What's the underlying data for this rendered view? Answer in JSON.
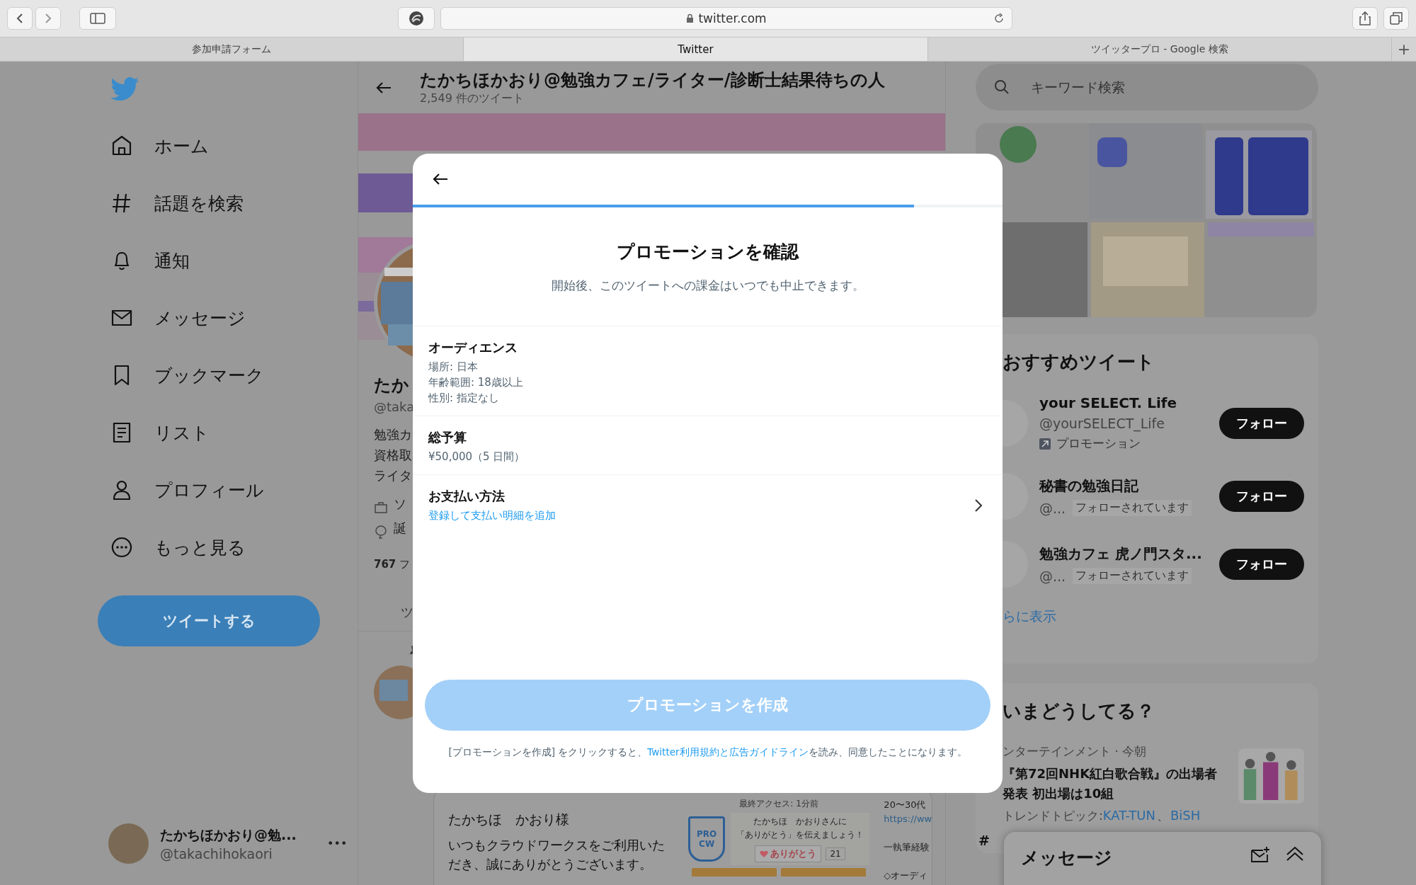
{
  "browser": {
    "url": "twitter.com",
    "tabs": [
      {
        "label": "参加申請フォーム",
        "selected": false
      },
      {
        "label": "Twitter",
        "selected": true
      },
      {
        "label": "ツイッタープロ - Google 検索",
        "selected": false
      }
    ],
    "new_tab": "+"
  },
  "nav": {
    "items": [
      {
        "label": "ホーム",
        "kind": "home"
      },
      {
        "label": "話題を検索",
        "kind": "hash"
      },
      {
        "label": "通知",
        "kind": "bell"
      },
      {
        "label": "メッセージ",
        "kind": "mail"
      },
      {
        "label": "ブックマーク",
        "kind": "bookmark"
      },
      {
        "label": "リスト",
        "kind": "list"
      },
      {
        "label": "プロフィール",
        "kind": "person"
      },
      {
        "label": "もっと見る",
        "kind": "more"
      }
    ],
    "tweet_button": "ツイートする",
    "account": {
      "name": "たかちほかおり@勉...",
      "handle": "@takachihokaori",
      "more": "•••"
    }
  },
  "profile": {
    "name": "たかちほかおり@勉強カフェ/ライター/診断士結果待ちの人",
    "tweet_count": "2,549 件のツイート",
    "name_fragment": "たか",
    "handle_fragment": "@taka",
    "bio_lines": [
      "勉強カ",
      "資格取",
      "ライタ"
    ],
    "meta": [
      {
        "kind": "work",
        "text": "ソ"
      },
      {
        "kind": "birthday",
        "text": "誕"
      }
    ],
    "following": "**767** フ",
    "tab_fragment": "ツ",
    "tweet_card": {
      "greeting": "たかちほ　かおり様",
      "message": "いつもクラウドワークスをご利用いただき、誠にありがとうございます。",
      "last_access": "最終アクセス: 1分前",
      "badge": [
        "PRO",
        "CW"
      ],
      "thanks_lines": [
        "たかちほ　かおりさんに",
        "「ありがとう」を伝えましょう！"
      ],
      "thanks_button": "ありがとう",
      "thanks_count": "21",
      "side_lines": [
        "20〜30代",
        "https://ww",
        "一執筆経験",
        "◇オーディ"
      ]
    }
  },
  "modal": {
    "progress": {
      "level": 0.85
    },
    "title": "プロモーションを確認",
    "subtitle": "開始後、このツイートへの課金はいつでも中止できます。",
    "sections": [
      {
        "heading": "オーディエンス",
        "lines": [
          "場所: 日本",
          "年齢範囲: 18歳以上",
          "性別: 指定なし"
        ],
        "kind": "info"
      },
      {
        "heading": "総予算",
        "lines": [
          "¥50,000（5 日間）"
        ],
        "kind": "info"
      },
      {
        "heading": "お支払い方法",
        "lines": [
          "登録して支払い明細を追加"
        ],
        "kind": "link"
      }
    ],
    "button": {
      "label": "プロモーションを作成",
      "disabled": true
    },
    "footer": {
      "before": "[プロモーションを作成] をクリックすると、",
      "link": "Twitter利用規約と広告ガイドライン",
      "after": "を読み、同意したことになります。"
    }
  },
  "right": {
    "search": {
      "placeholder": "キーワード検索"
    },
    "recommended": {
      "title": "おすすめツイート",
      "users": [
        {
          "name": "your SELECT. Life",
          "handle": "@yourSELECT_Life",
          "note": "プロモーション",
          "kind": "promoted",
          "follow": "フォロー"
        },
        {
          "name": "秘書の勉強日記",
          "handle": "@...",
          "note": "フォローされています",
          "kind": "follows_you",
          "follow": "フォロー"
        },
        {
          "name": "勉強カフェ 虎ノ門スタ...",
          "handle": "@...",
          "note": "フォローされています",
          "kind": "follows_you",
          "follow": "フォロー"
        }
      ],
      "more": "らに表示"
    },
    "trends": {
      "title": "いまどうしてる？",
      "items": [
        {
          "meta": "ンターテインメント · 今朝",
          "headline": "『第72回NHK紅白歌合戦』の出場者発表 初出場は10組",
          "topics_label": "トレンドトピック: ",
          "topics": [
            "KAT-TUN",
            "BiSH"
          ],
          "topics_separator": "、"
        }
      ],
      "next_fragment": "#"
    },
    "messages_drawer": {
      "title": "メッセージ"
    }
  }
}
